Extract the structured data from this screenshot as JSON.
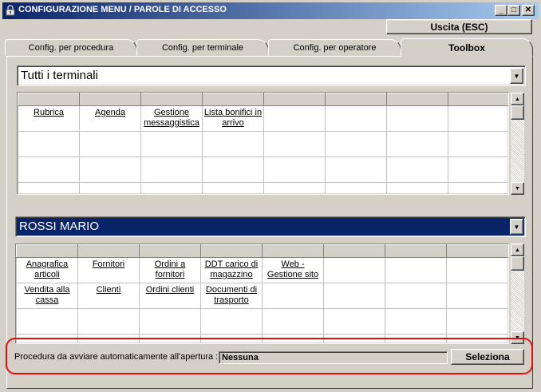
{
  "window": {
    "title": "CONFIGURAZIONE MENU / PAROLE DI ACCESSO",
    "minimize_glyph": "_",
    "maximize_glyph": "□",
    "close_glyph": "✕"
  },
  "exit_button": "Uscita (ESC)",
  "tabs": [
    {
      "label": "Config. per procedura"
    },
    {
      "label": "Config. per terminale"
    },
    {
      "label": "Config. per operatore"
    },
    {
      "label": "Toolbox"
    }
  ],
  "terminal_combo": {
    "value": "Tutti i terminali"
  },
  "grid1": {
    "rows": [
      [
        "Rubrica",
        "Agenda",
        "Gestione messaggistica",
        "Lista bonifici in arrivo",
        "",
        "",
        "",
        ""
      ],
      [
        "",
        "",
        "",
        "",
        "",
        "",
        "",
        ""
      ],
      [
        "",
        "",
        "",
        "",
        "",
        "",
        "",
        ""
      ],
      [
        "",
        "",
        "",
        "",
        "",
        "",
        "",
        ""
      ]
    ]
  },
  "operator_combo": {
    "value": "ROSSI MARIO"
  },
  "grid2": {
    "rows": [
      [
        "Anagrafica articoli",
        "Fornitori",
        "Ordini a fornitori",
        "DDT carico di magazzino",
        "Web - Gestione sito",
        "",
        "",
        ""
      ],
      [
        "Vendita alla cassa",
        "Clienti",
        "Ordini clienti",
        "Documenti di trasporto",
        "",
        "",
        "",
        ""
      ],
      [
        "",
        "",
        "",
        "",
        "",
        "",
        "",
        ""
      ],
      [
        "",
        "",
        "",
        "",
        "",
        "",
        "",
        ""
      ]
    ]
  },
  "auto_start": {
    "label": "Procedura da avviare automaticamente all'apertura :",
    "value": "Nessuna",
    "button": "Seleziona"
  },
  "colors": {
    "title_gradient_start": "#0a246a",
    "selected_row": "#0a246a",
    "highlight_outline": "#e01010"
  },
  "icons": {
    "app": "lock-icon",
    "dropdown": "dropdown-arrow-icon",
    "scroll_up": "scroll-up-icon",
    "scroll_down": "scroll-down-icon"
  }
}
